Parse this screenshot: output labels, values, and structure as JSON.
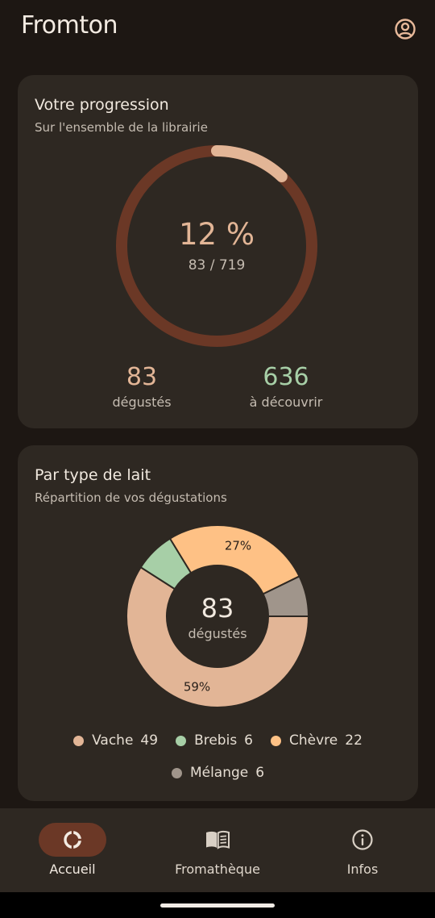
{
  "app": {
    "title": "Fromton",
    "account_icon": "account-circle-icon"
  },
  "progress": {
    "title": "Votre progression",
    "subtitle": "Sur l'ensemble de la librairie",
    "percent": 12,
    "percent_label": "12 %",
    "ratio_label": "83 / 719",
    "tasted": {
      "value": "83",
      "label": "dégustés"
    },
    "remaining": {
      "value": "636",
      "label": "à découvrir"
    },
    "colors": {
      "track": "#6b3826",
      "fill": "#e2b596",
      "tasted": "#e2b596",
      "remaining": "#a7cfa7"
    }
  },
  "milk": {
    "title": "Par type de lait",
    "subtitle": "Répartition de vos dégustations",
    "center_value": "83",
    "center_label": "dégustés",
    "legend": [
      {
        "name": "Vache",
        "count": "49",
        "color": "#e2b596"
      },
      {
        "name": "Brebis",
        "count": "6",
        "color": "#a7cfa7"
      },
      {
        "name": "Chèvre",
        "count": "22",
        "color": "#fec185"
      },
      {
        "name": "Mélange",
        "count": "6",
        "color": "#a0958b"
      }
    ],
    "slice_labels": {
      "vache": "59%",
      "chevre": "27%"
    }
  },
  "chart_data": {
    "type": "pie",
    "title": "Par type de lait",
    "categories": [
      "Vache",
      "Brebis",
      "Chèvre",
      "Mélange"
    ],
    "values": [
      49,
      6,
      22,
      6
    ],
    "colors": [
      "#e2b596",
      "#a7cfa7",
      "#fec185",
      "#a0958b"
    ],
    "data_labels": [
      "59%",
      "",
      "27%",
      ""
    ]
  },
  "nav": {
    "items": [
      {
        "label": "Accueil",
        "icon": "donut-chart-icon",
        "active": true
      },
      {
        "label": "Fromathèque",
        "icon": "book-icon",
        "active": false
      },
      {
        "label": "Infos",
        "icon": "info-icon",
        "active": false
      }
    ],
    "active_color": "#6b3826"
  }
}
